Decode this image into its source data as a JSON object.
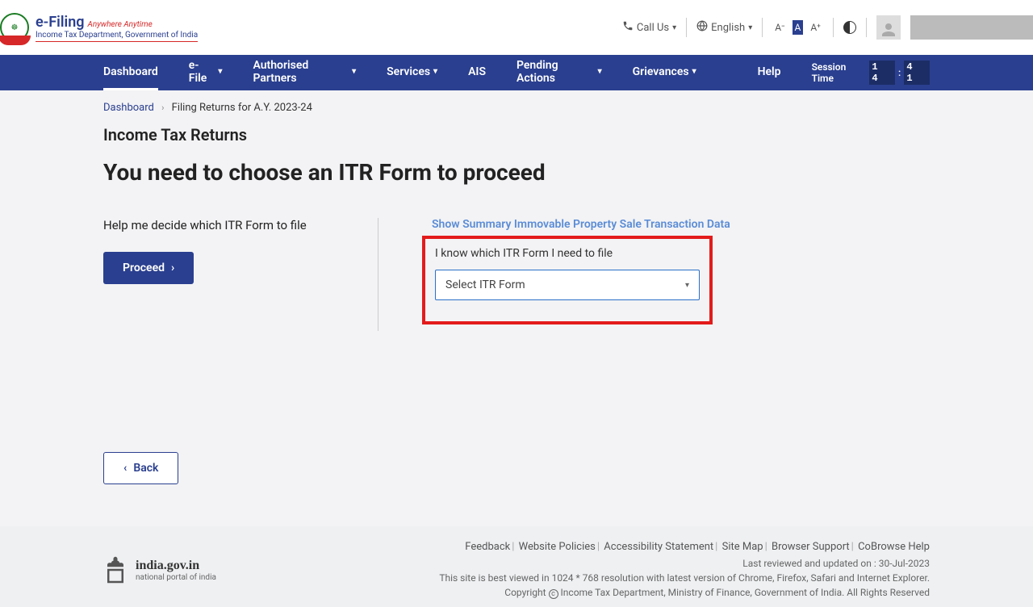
{
  "header": {
    "efiling_main": "e-Filing",
    "efiling_tag": "Anywhere Anytime",
    "efiling_sub": "Income Tax Department, Government of India",
    "call_us": "Call Us",
    "language": "English",
    "font_small": "A⁻",
    "font_normal": "A",
    "font_large": "A⁺"
  },
  "nav": {
    "dashboard": "Dashboard",
    "efile": "e-File",
    "authorised": "Authorised Partners",
    "services": "Services",
    "ais": "AIS",
    "pending": "Pending Actions",
    "grievances": "Grievances",
    "help": "Help",
    "session_label": "Session Time",
    "session_mm": "1 4",
    "session_sep": ":",
    "session_ss": "4 1"
  },
  "breadcrumb": {
    "dashboard": "Dashboard",
    "current": "Filing Returns for A.Y. 2023-24"
  },
  "page": {
    "section_title": "Income Tax Returns",
    "page_title": "You need to choose an ITR Form to proceed",
    "help_text": "Help me decide which ITR Form to file",
    "proceed": "Proceed",
    "summary_link": "Show Summary Immovable Property Sale Transaction Data",
    "know_label": "I know which ITR Form I need to file",
    "select_placeholder": "Select ITR Form",
    "back": "Back"
  },
  "footer": {
    "india_gov": "india.gov.in",
    "india_sub": "national portal of india",
    "links": {
      "feedback": "Feedback",
      "policies": "Website Policies",
      "accessibility": "Accessibility Statement",
      "sitemap": "Site Map",
      "browser": "Browser Support",
      "cobrowse": "CoBrowse Help"
    },
    "reviewed_label": "Last reviewed and updated on :",
    "reviewed_date": "30-Jul-2023",
    "bestview": "This site is best viewed in 1024 * 768 resolution with latest version of Chrome, Firefox, Safari and Internet Explorer.",
    "copyright_pre": "Copyright",
    "copyright_post": "Income Tax Department, Ministry of Finance, Government of India. All Rights Reserved"
  }
}
